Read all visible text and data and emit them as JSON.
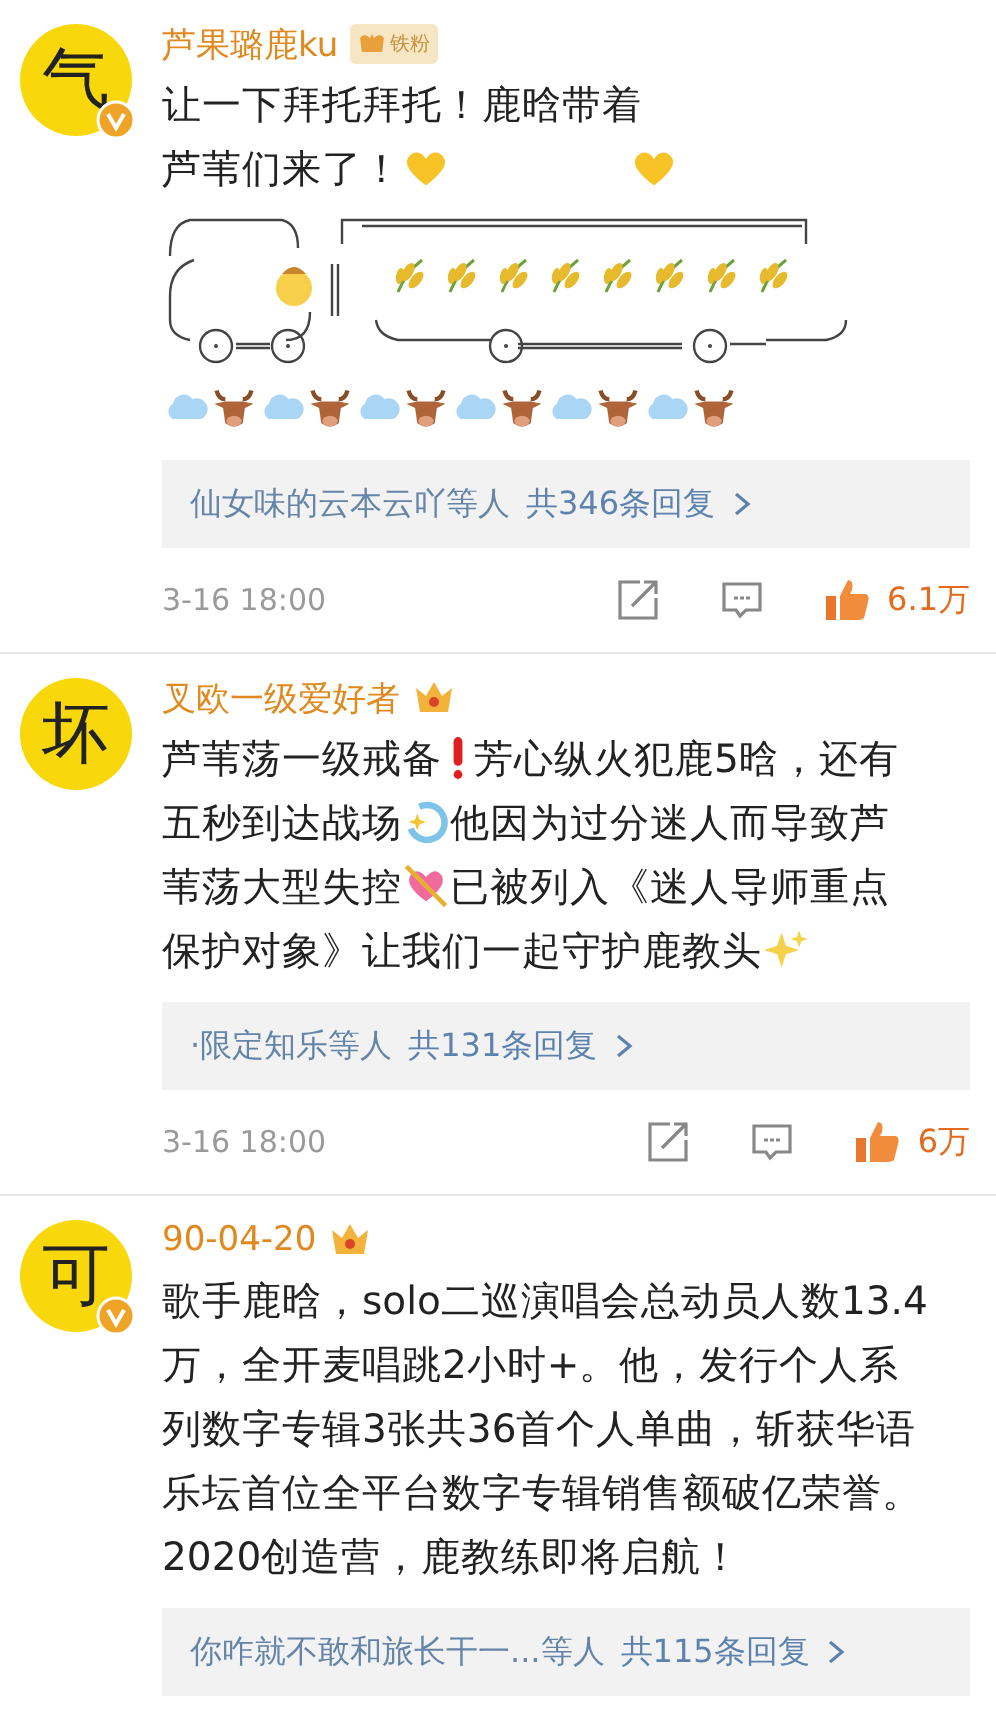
{
  "comments": [
    {
      "avatar_text": "气",
      "verified": true,
      "name": "芦果璐鹿ku",
      "badge": {
        "kind": "fan",
        "label": "铁粉"
      },
      "lines": [
        [
          {
            "kind": "text",
            "text": "让一下拜托拜托！鹿晗带着"
          }
        ],
        [
          {
            "kind": "text",
            "text": "芦苇们来了！"
          },
          {
            "kind": "heart"
          },
          {
            "kind": "gap"
          },
          {
            "kind": "heart"
          }
        ],
        [
          {
            "kind": "train"
          }
        ],
        [
          {
            "kind": "cloud"
          },
          {
            "kind": "ox"
          },
          {
            "kind": "cloud"
          },
          {
            "kind": "ox"
          },
          {
            "kind": "cloud"
          },
          {
            "kind": "ox"
          },
          {
            "kind": "cloud"
          },
          {
            "kind": "ox"
          },
          {
            "kind": "cloud"
          },
          {
            "kind": "ox"
          },
          {
            "kind": "cloud"
          },
          {
            "kind": "ox"
          }
        ]
      ],
      "replies": {
        "who": "仙女味的云本云吖等人",
        "count": "共346条回复"
      },
      "footer": {
        "time": "3-16 18:00",
        "likes": "6.1万"
      }
    },
    {
      "avatar_text": "坏",
      "verified": false,
      "name": "叉欧一级爱好者",
      "badge": {
        "kind": "crown"
      },
      "lines": [
        [
          {
            "kind": "text",
            "text": "芦苇荡一级戒备"
          },
          {
            "kind": "exclamation"
          },
          {
            "kind": "text",
            "text": "芳心纵火犯鹿5晗，还有"
          }
        ],
        [
          {
            "kind": "text",
            "text": "五秒到达战场"
          },
          {
            "kind": "dizzy"
          },
          {
            "kind": "text",
            "text": "他因为过分迷人而导致芦"
          }
        ],
        [
          {
            "kind": "text",
            "text": "苇荡大型失控"
          },
          {
            "kind": "cupid"
          },
          {
            "kind": "text",
            "text": "已被列入《迷人导师重点"
          }
        ],
        [
          {
            "kind": "text",
            "text": "保护对象》让我们一起守护鹿教头"
          },
          {
            "kind": "sparkles"
          }
        ]
      ],
      "replies": {
        "who": "·限定知乐等人",
        "count": "共131条回复"
      },
      "footer": {
        "time": "3-16 18:00",
        "likes": "6万"
      }
    },
    {
      "avatar_text": "可",
      "verified": true,
      "name": "90-04-20",
      "badge": {
        "kind": "crown"
      },
      "lines": [
        [
          {
            "kind": "text",
            "text": "歌手鹿晗，solo二巡演唱会总动员人数13.4"
          }
        ],
        [
          {
            "kind": "text",
            "text": "万，全开麦唱跳2小时+。他，发行个人系"
          }
        ],
        [
          {
            "kind": "text",
            "text": "列数字专辑3张共36首个人单曲，斩获华语"
          }
        ],
        [
          {
            "kind": "text",
            "text": "乐坛首位全平台数字专辑销售额破亿荣誉。"
          }
        ],
        [
          {
            "kind": "text",
            "text": "2020创造营，鹿教练即将启航！"
          }
        ]
      ],
      "replies": {
        "who": "你咋就不敢和旅长干一...等人",
        "count": "共115条回复"
      }
    }
  ]
}
